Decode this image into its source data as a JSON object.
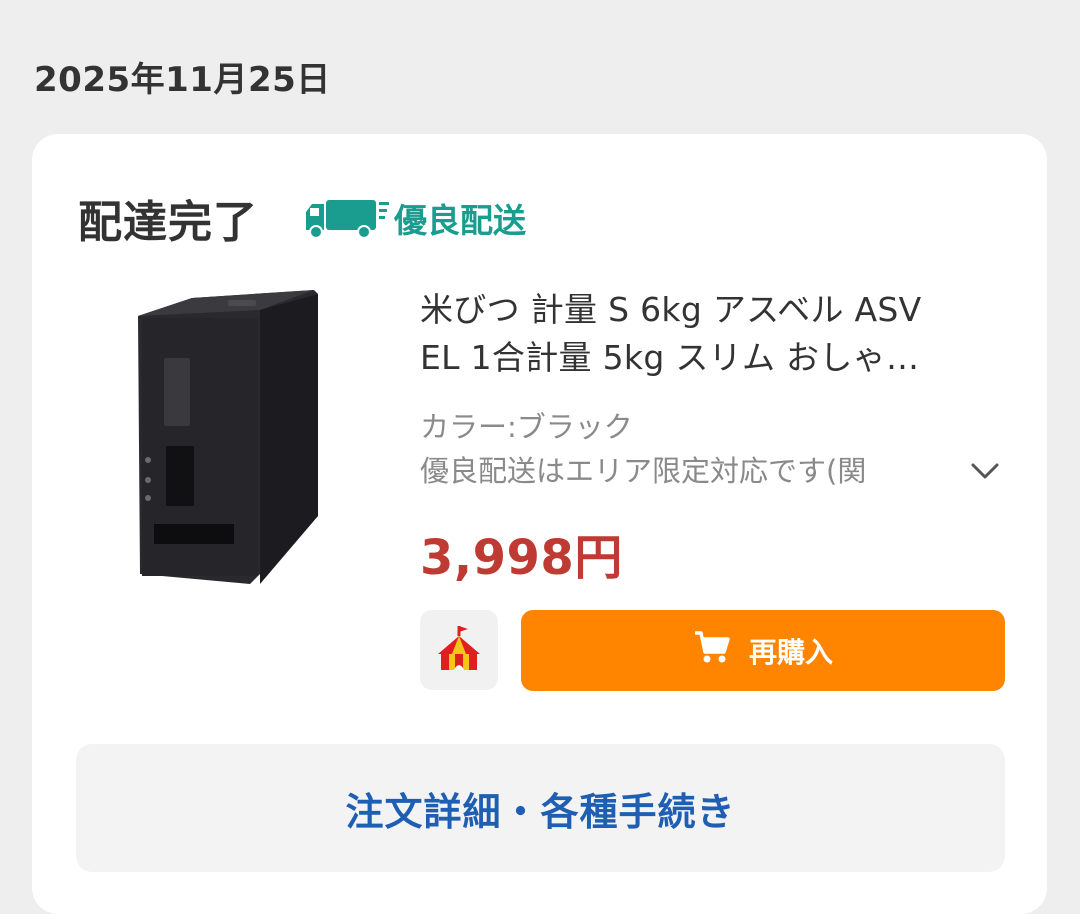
{
  "order_date": "2025年11月25日",
  "card": {
    "status": "配達完了",
    "shipping_badge": "優良配送",
    "product": {
      "title": "米びつ 計量 S 6kg アスベル ASV\nEL 1合計量 5kg スリム おしゃ…",
      "variant": "カラー:ブラック",
      "note": "優良配送はエリア限定対応です(関",
      "price": "3,998円"
    },
    "rebuy_label": "再購入",
    "details_label": "注文詳細・各種手続き"
  },
  "colors": {
    "badge": "#1a9c8f",
    "price": "#bf3a33",
    "rebuy_button": "#ff8400",
    "details_link": "#1f5fb3"
  },
  "icons": [
    "truck-icon",
    "chevron-down-icon",
    "store-tent-icon",
    "cart-icon"
  ]
}
